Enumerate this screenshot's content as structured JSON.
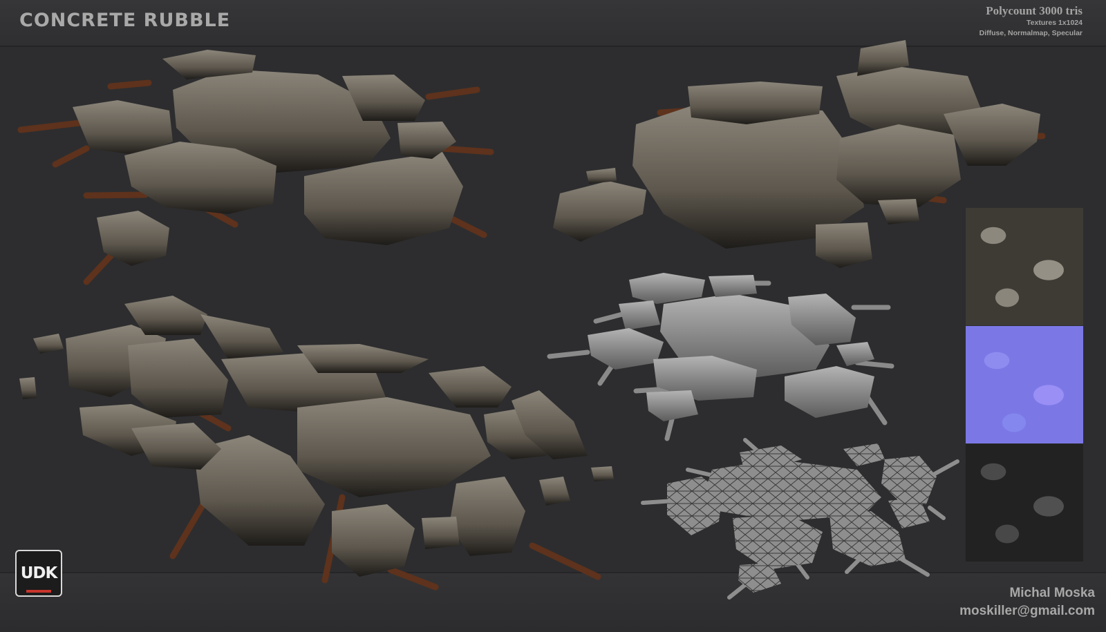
{
  "header": {
    "title": "CONCRETE RUBBLE",
    "polycount": "Polycount 3000 tris",
    "textures": "Textures 1x1024",
    "maps": "Diffuse, Normalmap, Specular"
  },
  "footer": {
    "author": "Michal Moska",
    "email": "moskiller@gmail.com",
    "logo_text": "UDK"
  },
  "colors": {
    "background": "#2d2d2f",
    "concrete": "#6e685c",
    "rebar": "#6a3a22",
    "clay": "#9a9a9a",
    "normal_map": "#7b78e6"
  }
}
